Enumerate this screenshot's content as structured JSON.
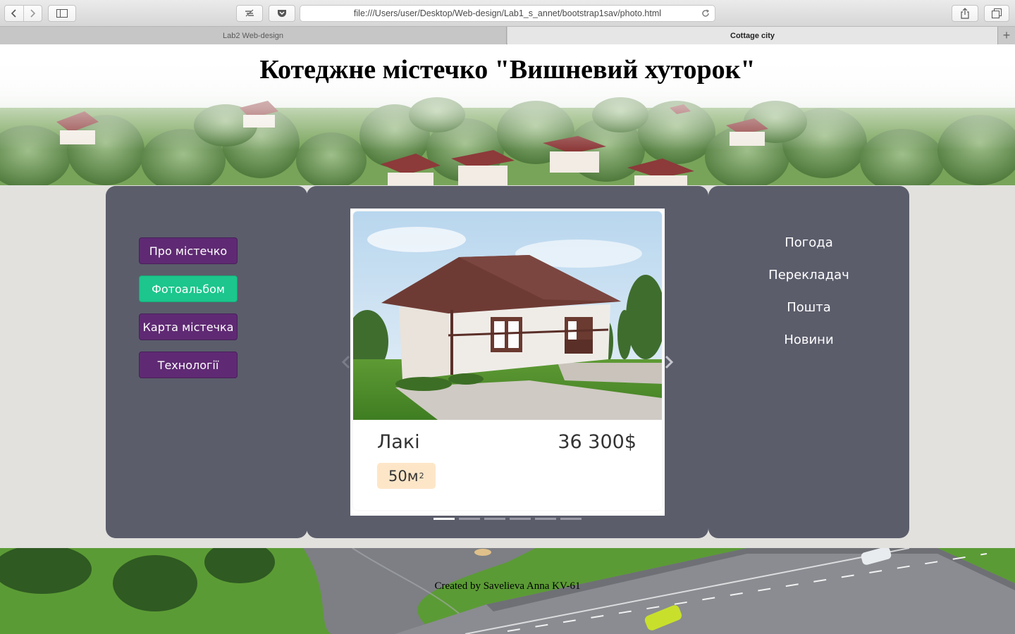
{
  "browser": {
    "url": "file:///Users/user/Desktop/Web-design/Lab1_s_annet/bootstrap1sav/photo.html",
    "tabs": [
      {
        "label": "Lab2 Web-design",
        "active": false
      },
      {
        "label": "Cottage city",
        "active": true
      }
    ]
  },
  "header": {
    "title": "Котеджне містечко \"Вишневий хуторок\""
  },
  "left_menu": {
    "items": [
      {
        "label": "Про містечко",
        "active": false
      },
      {
        "label": "Фотоальбом",
        "active": true
      },
      {
        "label": "Карта містечка",
        "active": false
      },
      {
        "label": "Технології",
        "active": false
      }
    ]
  },
  "carousel": {
    "slide": {
      "name": "Лакі",
      "price": "36 300$",
      "area": "50м",
      "area_unit_sup": "2"
    },
    "indicator_count": 6,
    "active_index": 0
  },
  "right_menu": {
    "items": [
      "Погода",
      "Перекладач",
      "Пошта",
      "Новини"
    ]
  },
  "footer": {
    "text": "Created by Savelieva Anna KV-61"
  },
  "colors": {
    "panel": "#5b5d6b",
    "menu_button": "#5f2a73",
    "menu_button_active": "#1cc68c",
    "area_badge": "#fde6c8"
  }
}
